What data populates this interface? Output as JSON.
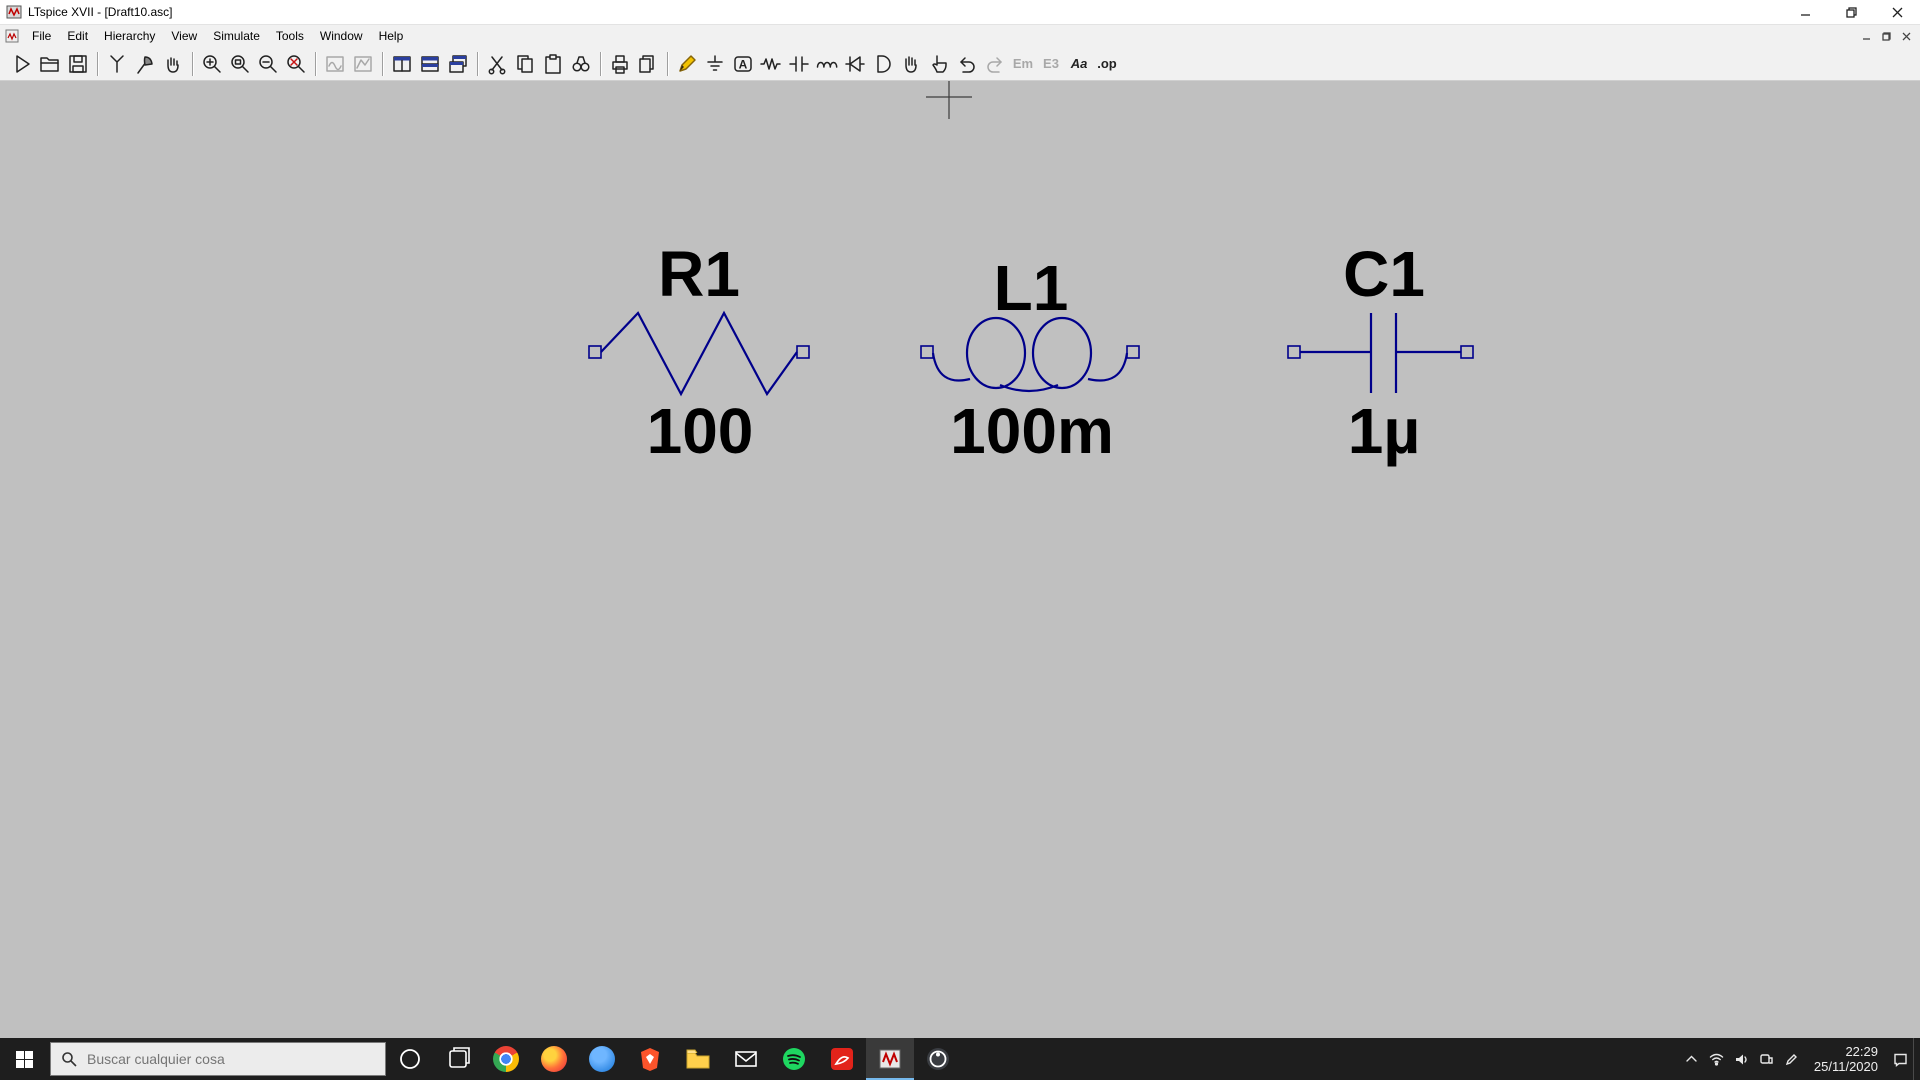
{
  "window": {
    "title": "LTspice XVII - [Draft10.asc]"
  },
  "menu": {
    "items": [
      "File",
      "Edit",
      "Hierarchy",
      "View",
      "Simulate",
      "Tools",
      "Window",
      "Help"
    ]
  },
  "toolbar": {
    "icons": [
      "run-icon",
      "open-icon",
      "save-icon",
      "probe-icon",
      "halt-axe-icon",
      "pan-hand-icon",
      "zoom-in-icon",
      "zoom-area-icon",
      "zoom-out-icon",
      "zoom-clear-icon",
      "autorange-icon",
      "plot-settings-icon",
      "tile-vertical-icon",
      "tile-horizontal-icon",
      "cascade-icon",
      "cut-icon",
      "copy-icon",
      "paste-icon",
      "find-icon",
      "print-icon",
      "print-all-icon",
      "wire-icon",
      "ground-icon",
      "label-icon",
      "resistor-icon",
      "capacitor-icon",
      "inductor-icon",
      "diode-icon",
      "component-icon",
      "move-icon",
      "drag-icon",
      "undo-icon",
      "redo-icon",
      "mirror-icon",
      "rotate-icon",
      "text-icon",
      "spice-directive-icon"
    ],
    "text_icons": {
      "mirror": "Em",
      "rotate": "E3",
      "text": "Aa",
      "op": ".op"
    }
  },
  "schematic": {
    "colors": {
      "wire": "#00008b",
      "canvas": "#c0c0c0",
      "label": "#000000"
    },
    "components": [
      {
        "type": "resistor",
        "ref": "R1",
        "value": "100"
      },
      {
        "type": "inductor",
        "ref": "L1",
        "value": "100m"
      },
      {
        "type": "capacitor",
        "ref": "C1",
        "value": "1µ"
      }
    ]
  },
  "taskbar": {
    "search_placeholder": "Buscar cualquier cosa",
    "apps": [
      "start-button",
      "cortana-icon",
      "task-view-icon",
      "chrome-icon",
      "firefox-icon",
      "thunderbird-icon",
      "brave-icon",
      "file-explorer-icon",
      "mail-icon",
      "spotify-icon",
      "acrobat-icon",
      "ltspice-icon",
      "obs-icon"
    ],
    "active_app": "ltspice-icon",
    "tray": {
      "icons": [
        "chevron-up-icon",
        "wifi-icon",
        "volume-icon",
        "teams-icon",
        "pen-icon",
        "notification-icon"
      ],
      "time": "22:29",
      "date": "25/11/2020"
    }
  }
}
